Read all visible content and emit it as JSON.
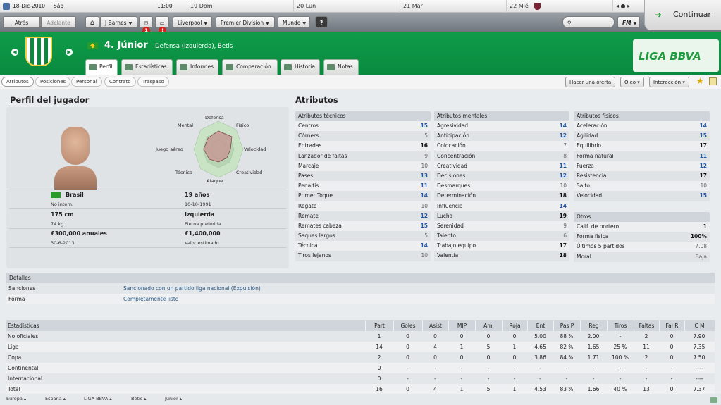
{
  "calendar": {
    "date": "18-Dic-2010",
    "day": "Sáb",
    "time": "11:00",
    "days": [
      {
        "num": "19",
        "name": "Dom"
      },
      {
        "num": "20",
        "name": "Lun"
      },
      {
        "num": "21",
        "name": "Mar"
      },
      {
        "num": "22",
        "name": "Mié"
      }
    ]
  },
  "nav": {
    "back": "Atrás",
    "forward": "Adelante",
    "manager": "J Barnes",
    "team": "Liverpool",
    "league": "Premier Division",
    "world": "Mundo",
    "help": "?",
    "badge1": "1",
    "badge2": "!",
    "fm": "FM",
    "continue": "Continuar"
  },
  "player": {
    "number_name": "4. Júnior",
    "position": "Defensa (Izquierda), Betis",
    "nationality": "Brasil",
    "intl": "No intern.",
    "age": "19 años",
    "dob": "10-10-1991",
    "height": "175 cm",
    "weight": "74 kg",
    "foot": "Izquierda",
    "foot_label": "Pierna preferida",
    "wage": "£300,000 anuales",
    "contract_end": "30-6-2013",
    "value": "£1,400,000",
    "value_label": "Valor estimado"
  },
  "league_logo": "LIGA BBVA",
  "tabs": [
    "Perfil",
    "Estadísticas",
    "Informes",
    "Comparación",
    "Historia",
    "Notas"
  ],
  "subtabs": [
    "Atributos",
    "Posiciones",
    "Personal",
    "Contrato",
    "Traspaso"
  ],
  "actions": {
    "offer": "Hacer una oferta",
    "scout": "Ojeo",
    "interact": "Interacción"
  },
  "profile_title": "Perfil del jugador",
  "attributes_title": "Atributos",
  "radar_labels": [
    "Defensa",
    "Físico",
    "Velocidad",
    "Creatividad",
    "Ataque",
    "Técnica",
    "Juego aéreo",
    "Mental"
  ],
  "technical": {
    "title": "Atributos técnicos",
    "rows": [
      [
        "Centros",
        "15",
        "b"
      ],
      [
        "Córners",
        "5",
        "g"
      ],
      [
        "Entradas",
        "16",
        "d"
      ],
      [
        "Lanzador de faltas",
        "9",
        "g"
      ],
      [
        "Marcaje",
        "10",
        "g"
      ],
      [
        "Pases",
        "13",
        "b"
      ],
      [
        "Penaltis",
        "11",
        "b"
      ],
      [
        "Primer Toque",
        "14",
        "b"
      ],
      [
        "Regate",
        "10",
        "g"
      ],
      [
        "Remate",
        "12",
        "b"
      ],
      [
        "Remates cabeza",
        "15",
        "b"
      ],
      [
        "Saques largos",
        "5",
        "g"
      ],
      [
        "Técnica",
        "14",
        "b"
      ],
      [
        "Tiros lejanos",
        "10",
        "g"
      ]
    ]
  },
  "mental": {
    "title": "Atributos mentales",
    "rows": [
      [
        "Agresividad",
        "14",
        "b"
      ],
      [
        "Anticipación",
        "12",
        "b"
      ],
      [
        "Colocación",
        "7",
        "g"
      ],
      [
        "Concentración",
        "8",
        "g"
      ],
      [
        "Creatividad",
        "11",
        "b"
      ],
      [
        "Decisiones",
        "12",
        "b"
      ],
      [
        "Desmarques",
        "10",
        "g"
      ],
      [
        "Determinación",
        "18",
        "d"
      ],
      [
        "Influencia",
        "14",
        "b"
      ],
      [
        "Lucha",
        "19",
        "d"
      ],
      [
        "Serenidad",
        "9",
        "g"
      ],
      [
        "Talento",
        "6",
        "g"
      ],
      [
        "Trabajo equipo",
        "17",
        "d"
      ],
      [
        "Valentía",
        "18",
        "d"
      ]
    ]
  },
  "physical": {
    "title": "Atributos físicos",
    "rows": [
      [
        "Aceleración",
        "14",
        "b"
      ],
      [
        "Agilidad",
        "15",
        "b"
      ],
      [
        "Equilibrio",
        "17",
        "d"
      ],
      [
        "Forma natural",
        "11",
        "b"
      ],
      [
        "Fuerza",
        "12",
        "b"
      ],
      [
        "Resistencia",
        "17",
        "d"
      ],
      [
        "Salto",
        "10",
        "g"
      ],
      [
        "Velocidad",
        "15",
        "b"
      ]
    ]
  },
  "other": {
    "title": "Otros",
    "rows": [
      [
        "Calif. de portero",
        "1",
        "d"
      ],
      [
        "Forma física",
        "100%",
        "d"
      ],
      [
        "Últimos 5 partidos",
        "7.08",
        "g"
      ],
      [
        "Moral",
        "Baja",
        "g"
      ]
    ]
  },
  "details": {
    "title": "Detalles",
    "rows": [
      [
        "Sanciones",
        "Sancionado con un partido liga nacional (Expulsión)"
      ],
      [
        "Forma",
        "Completamente listo"
      ]
    ]
  },
  "stats": {
    "headers": [
      "Estadísticas",
      "Part",
      "Goles",
      "Asist",
      "MJP",
      "Am.",
      "Roja",
      "Ent",
      "Pas P",
      "Reg",
      "Tiros",
      "Faltas",
      "Fal R",
      "C M"
    ],
    "rows": [
      [
        "No oficiales",
        "1",
        "0",
        "0",
        "0",
        "0",
        "0",
        "5.00",
        "88 %",
        "2.00",
        "-",
        "2",
        "0",
        "7.90"
      ],
      [
        "Liga",
        "14",
        "0",
        "4",
        "1",
        "5",
        "1",
        "4.65",
        "82 %",
        "1.65",
        "25 %",
        "11",
        "0",
        "7.35"
      ],
      [
        "Copa",
        "2",
        "0",
        "0",
        "0",
        "0",
        "0",
        "3.86",
        "84 %",
        "1.71",
        "100 %",
        "2",
        "0",
        "7.50"
      ],
      [
        "Continental",
        "0",
        "-",
        "-",
        "-",
        "-",
        "-",
        "-",
        "-",
        "-",
        "-",
        "-",
        "-",
        "----"
      ],
      [
        "Internacional",
        "0",
        "-",
        "-",
        "-",
        "-",
        "-",
        "-",
        "-",
        "-",
        "-",
        "-",
        "-",
        "----"
      ],
      [
        "Total",
        "16",
        "0",
        "4",
        "1",
        "5",
        "1",
        "4.53",
        "83 %",
        "1.66",
        "40 %",
        "13",
        "0",
        "7.37"
      ]
    ]
  },
  "breadcrumbs": [
    "Europa",
    "España",
    "LIGA BBVA",
    "Betis",
    "Júnior"
  ],
  "colors": {
    "header_green": "#0e9c49",
    "blue_value": "#1f58a8"
  }
}
